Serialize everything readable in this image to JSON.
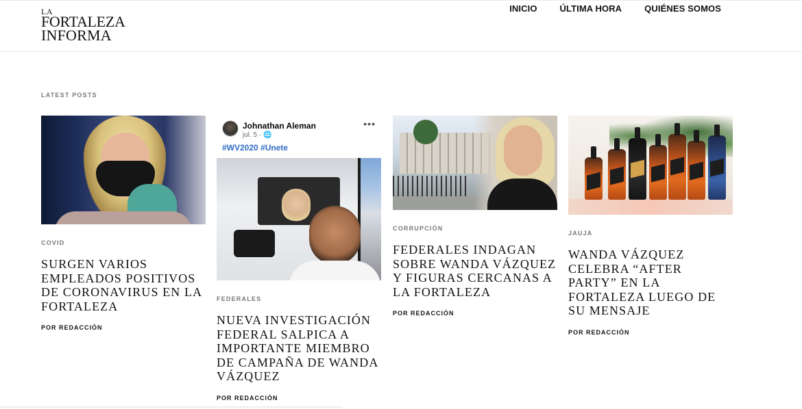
{
  "site": {
    "logo": {
      "line1": "LA",
      "line2": "FORTALEZA",
      "line3": "INFORMA"
    },
    "nav": [
      "INICIO",
      "ÚLTIMA HORA",
      "QUIÉNES SOMOS"
    ]
  },
  "section_label": "LATEST POSTS",
  "posts": [
    {
      "category": "COVID",
      "title": "SURGEN VARIOS EMPLEADOS POSITIVOS DE CORONAVIRUS EN LA FORTALEZA",
      "byline": "POR REDACCIÓN"
    },
    {
      "category": "FEDERALES",
      "title": "NUEVA INVESTIGACIÓN FEDERAL SALPICA A IMPORTANTE MIEMBRO DE CAMPAÑA DE WANDA VÁZQUEZ",
      "byline": "POR REDACCIÓN",
      "embed": {
        "author": "Johnathan Aleman",
        "meta": "jul. 5 · 🌐",
        "menu": "•••",
        "tags": "#WV2020 #Unete"
      }
    },
    {
      "category": "CORRUPCIÓN",
      "title": "FEDERALES INDAGAN SOBRE WANDA VÁZQUEZ Y FIGURAS CERCANAS A LA FORTALEZA",
      "byline": "POR REDACCIÓN"
    },
    {
      "category": "JAUJA",
      "title": "WANDA VÁZQUEZ CELEBRA “AFTER PARTY” EN LA FORTALEZA LUEGO DE SU MENSAJE",
      "byline": "POR REDACCIÓN"
    }
  ]
}
